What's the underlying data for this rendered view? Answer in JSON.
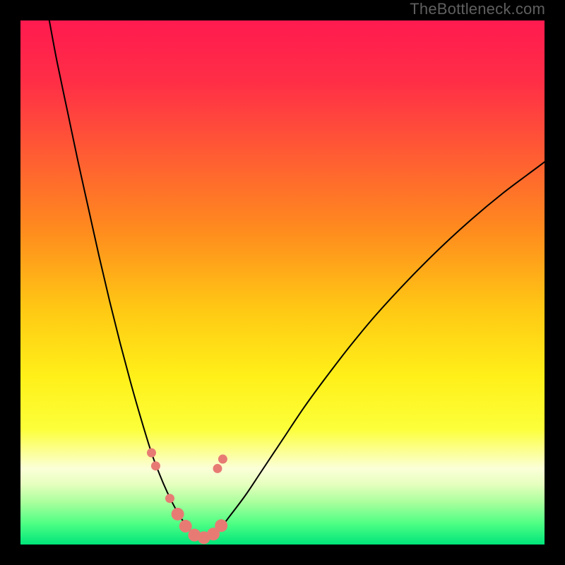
{
  "watermark": "TheBottleneck.com",
  "chart_data": {
    "type": "line",
    "title": "",
    "xlabel": "",
    "ylabel": "",
    "xlim": [
      0,
      100
    ],
    "ylim": [
      0,
      100
    ],
    "grid": false,
    "legend": false,
    "background_gradient": {
      "stops": [
        {
          "offset": 0.0,
          "color": "#ff1a4f"
        },
        {
          "offset": 0.12,
          "color": "#ff2f46"
        },
        {
          "offset": 0.25,
          "color": "#ff5a34"
        },
        {
          "offset": 0.4,
          "color": "#ff8b1e"
        },
        {
          "offset": 0.55,
          "color": "#ffc814"
        },
        {
          "offset": 0.68,
          "color": "#fff019"
        },
        {
          "offset": 0.78,
          "color": "#fcff3a"
        },
        {
          "offset": 0.855,
          "color": "#fbffd8"
        },
        {
          "offset": 0.885,
          "color": "#e6ffbe"
        },
        {
          "offset": 0.92,
          "color": "#a8ff9c"
        },
        {
          "offset": 0.96,
          "color": "#4eff84"
        },
        {
          "offset": 1.0,
          "color": "#00e57a"
        }
      ]
    },
    "series": [
      {
        "name": "left-curve",
        "color": "#000000",
        "width": 2,
        "x": [
          5.5,
          7,
          9,
          11,
          13,
          15,
          17,
          19,
          21,
          23,
          25,
          26.5,
          28,
          29.5,
          31,
          32.5,
          34
        ],
        "y": [
          100,
          92,
          82.5,
          73,
          64,
          55,
          46.5,
          38.5,
          31,
          24,
          17.5,
          13.5,
          10,
          7,
          4.5,
          2.5,
          1.3
        ]
      },
      {
        "name": "right-curve",
        "color": "#000000",
        "width": 2,
        "x": [
          36,
          38,
          40,
          43,
          46,
          50,
          54,
          58,
          63,
          68,
          74,
          80,
          86,
          92,
          98,
          100
        ],
        "y": [
          1.3,
          3,
          5.5,
          9.5,
          14,
          20,
          26,
          31.5,
          38,
          44,
          50.5,
          56.5,
          62,
          67,
          71.5,
          73
        ]
      }
    ],
    "markers": {
      "color": "#e77b74",
      "radius_small": 6.5,
      "radius_large": 9,
      "points": [
        {
          "x": 25.0,
          "y": 17.5,
          "r": "small"
        },
        {
          "x": 25.8,
          "y": 15.0,
          "r": "small"
        },
        {
          "x": 28.5,
          "y": 8.8,
          "r": "small"
        },
        {
          "x": 30.0,
          "y": 5.8,
          "r": "large"
        },
        {
          "x": 31.5,
          "y": 3.5,
          "r": "large"
        },
        {
          "x": 33.2,
          "y": 1.8,
          "r": "large"
        },
        {
          "x": 35.0,
          "y": 1.3,
          "r": "large"
        },
        {
          "x": 36.8,
          "y": 2.0,
          "r": "large"
        },
        {
          "x": 38.3,
          "y": 3.6,
          "r": "large"
        },
        {
          "x": 37.6,
          "y": 14.5,
          "r": "small"
        },
        {
          "x": 38.6,
          "y": 16.3,
          "r": "small"
        }
      ]
    }
  }
}
